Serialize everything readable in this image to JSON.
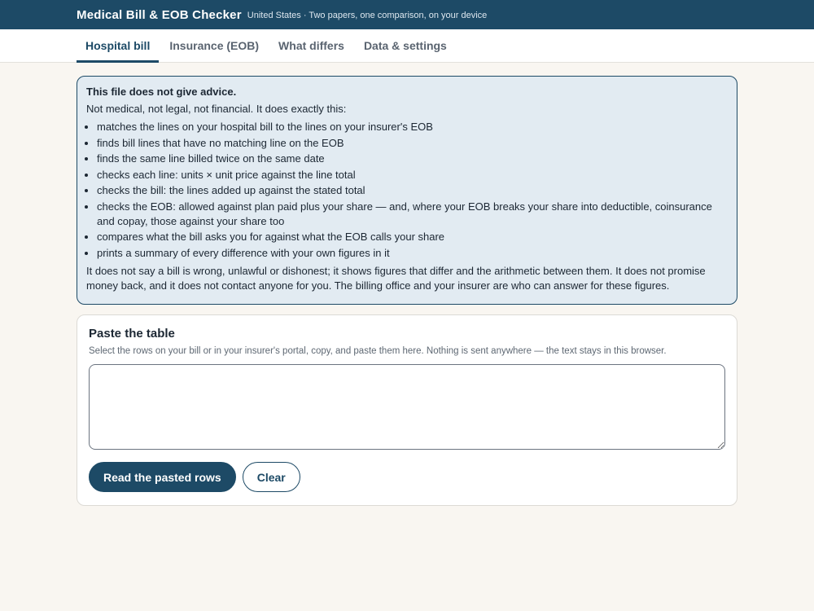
{
  "header": {
    "title": "Medical Bill & EOB Checker",
    "subtitle": "United States · Two papers, one comparison, on your device"
  },
  "tabs": [
    {
      "label": "Hospital bill",
      "active": true
    },
    {
      "label": "Insurance (EOB)",
      "active": false
    },
    {
      "label": "What differs",
      "active": false
    },
    {
      "label": "Data & settings",
      "active": false
    }
  ],
  "notice": {
    "heading": "This file does not give advice.",
    "intro": "Not medical, not legal, not financial. It does exactly this:",
    "items": [
      "matches the lines on your hospital bill to the lines on your insurer's EOB",
      "finds bill lines that have no matching line on the EOB",
      "finds the same line billed twice on the same date",
      "checks each line: units × unit price against the line total",
      "checks the bill: the lines added up against the stated total",
      "checks the EOB: allowed against plan paid plus your share — and, where your EOB breaks your share into deductible, coinsurance and copay, those against your share too",
      "compares what the bill asks you for against what the EOB calls your share",
      "prints a summary of every difference with your own figures in it"
    ],
    "footer": "It does not say a bill is wrong, unlawful or dishonest; it shows figures that differ and the arithmetic between them. It does not promise money back, and it does not contact anyone for you. The billing office and your insurer are who can answer for these figures."
  },
  "paste": {
    "title": "Paste the table",
    "description": "Select the rows on your bill or in your insurer's portal, copy, and paste them here. Nothing is sent anywhere — the text stays in this browser.",
    "value": "",
    "read_label": "Read the pasted rows",
    "clear_label": "Clear"
  },
  "colors": {
    "brand": "#1d4a66",
    "notice_background": "#e2ebf2",
    "page_background": "#f9f6f1"
  }
}
